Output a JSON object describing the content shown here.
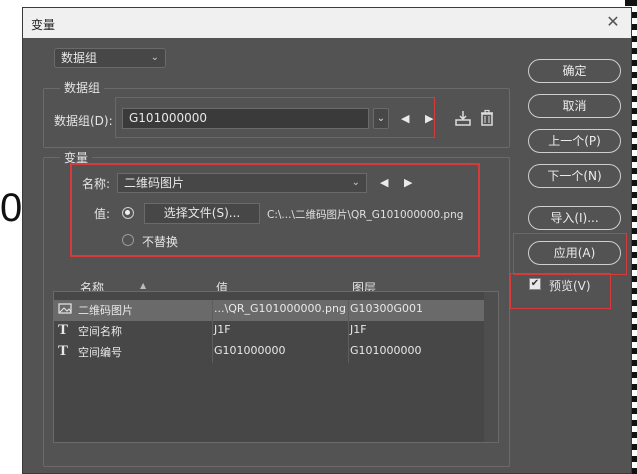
{
  "window": {
    "title": "变量",
    "close_glyph": "✕"
  },
  "top_dropdown": {
    "value": "数据组"
  },
  "dataset_group": {
    "label": "数据组",
    "field_label": "数据组(D):",
    "value": "G101000000"
  },
  "variables_group": {
    "label": "变量",
    "name_label": "名称:",
    "name_value": "二维码图片",
    "value_label": "值:",
    "choose_file_label": "选择文件(S)...",
    "file_path": "C:\\...\\二维码图片\\QR_G101000000.png",
    "no_replace_label": "不替换"
  },
  "table": {
    "headers": [
      "名称",
      "值",
      "图层"
    ],
    "rows": [
      {
        "icon": "image-variable-icon",
        "name": "二维码图片",
        "value": "...\\QR_G101000000.png",
        "layer": "G10300G001",
        "selected": true
      },
      {
        "icon": "text-variable-icon",
        "name": "空间名称",
        "value": "J1F",
        "layer": "J1F",
        "selected": false
      },
      {
        "icon": "text-variable-icon",
        "name": "空间编号",
        "value": "G101000000",
        "layer": "G101000000",
        "selected": false
      }
    ]
  },
  "buttons": {
    "ok": "确定",
    "cancel": "取消",
    "prev": "上一个(P)",
    "next": "下一个(N)",
    "import": "导入(I)...",
    "apply": "应用(A)"
  },
  "preview": {
    "label": "预览(V)",
    "checked": true
  },
  "background": {
    "partial_text": "0"
  },
  "colors": {
    "dialog_bg": "#535353",
    "highlight_red": "#d63a3a"
  }
}
